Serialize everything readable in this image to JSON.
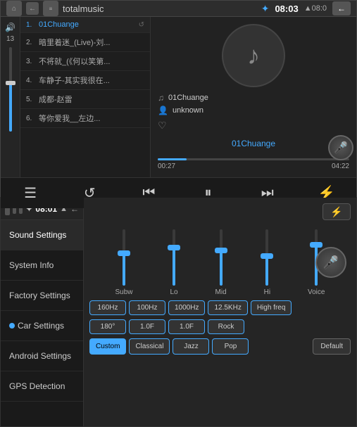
{
  "topBar": {
    "title": "totalmusic",
    "bluetooth": "bluetooth",
    "time": "08:03",
    "signal": "▲08:0",
    "backLabel": "←"
  },
  "volume": {
    "value": "13",
    "fillPercent": "60"
  },
  "playlist": {
    "items": [
      {
        "index": "1.",
        "title": "01Chuange",
        "active": true
      },
      {
        "index": "2.",
        "title": "暗里着迷_(Live)-刘..."
      },
      {
        "index": "3.",
        "title": "不将就_(《何以笑第..."
      },
      {
        "index": "4.",
        "title": "车静子-其实我很在..."
      },
      {
        "index": "5.",
        "title": "成都-赵雷"
      },
      {
        "index": "6.",
        "title": "等你爱我__左边..."
      }
    ]
  },
  "nowPlaying": {
    "trackName": "01Chuange",
    "artist": "unknown",
    "title": "01Chuange",
    "currentTime": "00:27",
    "totalTime": "04:22",
    "progressPercent": "12"
  },
  "transport": {
    "listIcon": "☰",
    "repeatIcon": "↺",
    "prevIcon": "⏮",
    "playPauseIcon": "⏸",
    "nextIcon": "⏭",
    "eqIcon": "⚙"
  },
  "bottomBar": {
    "time": "08:01",
    "signal": "▲",
    "back": "←"
  },
  "settingsSidebar": {
    "items": [
      {
        "label": "Sound Settings",
        "active": true
      },
      {
        "label": "System Info",
        "active": false
      },
      {
        "label": "Factory Settings",
        "active": false
      },
      {
        "label": "Car Settings",
        "active": false
      },
      {
        "label": "Android Settings",
        "active": false
      },
      {
        "label": "GPS Detection",
        "active": false
      }
    ]
  },
  "eq": {
    "channels": [
      {
        "label": "Subw",
        "fillHeight": "55",
        "thumbPos": "43"
      },
      {
        "label": "Lo",
        "fillHeight": "65",
        "thumbPos": "53"
      },
      {
        "label": "Mid",
        "fillHeight": "60",
        "thumbPos": "48"
      },
      {
        "label": "Hi",
        "fillHeight": "50",
        "thumbPos": "38"
      },
      {
        "label": "Voice",
        "fillHeight": "70",
        "thumbPos": "58"
      }
    ]
  },
  "freqButtons": [
    "160Hz",
    "100Hz",
    "1000Hz",
    "12.5KHz",
    "High freq"
  ],
  "valButtons": [
    "180°",
    "1.0F",
    "1.0F",
    "Rock"
  ],
  "presets": [
    {
      "label": "Custom",
      "active": true
    },
    {
      "label": "Classical",
      "active": false
    },
    {
      "label": "Jazz",
      "active": false
    },
    {
      "label": "Pop",
      "active": false
    }
  ],
  "defaultBtn": "Default"
}
